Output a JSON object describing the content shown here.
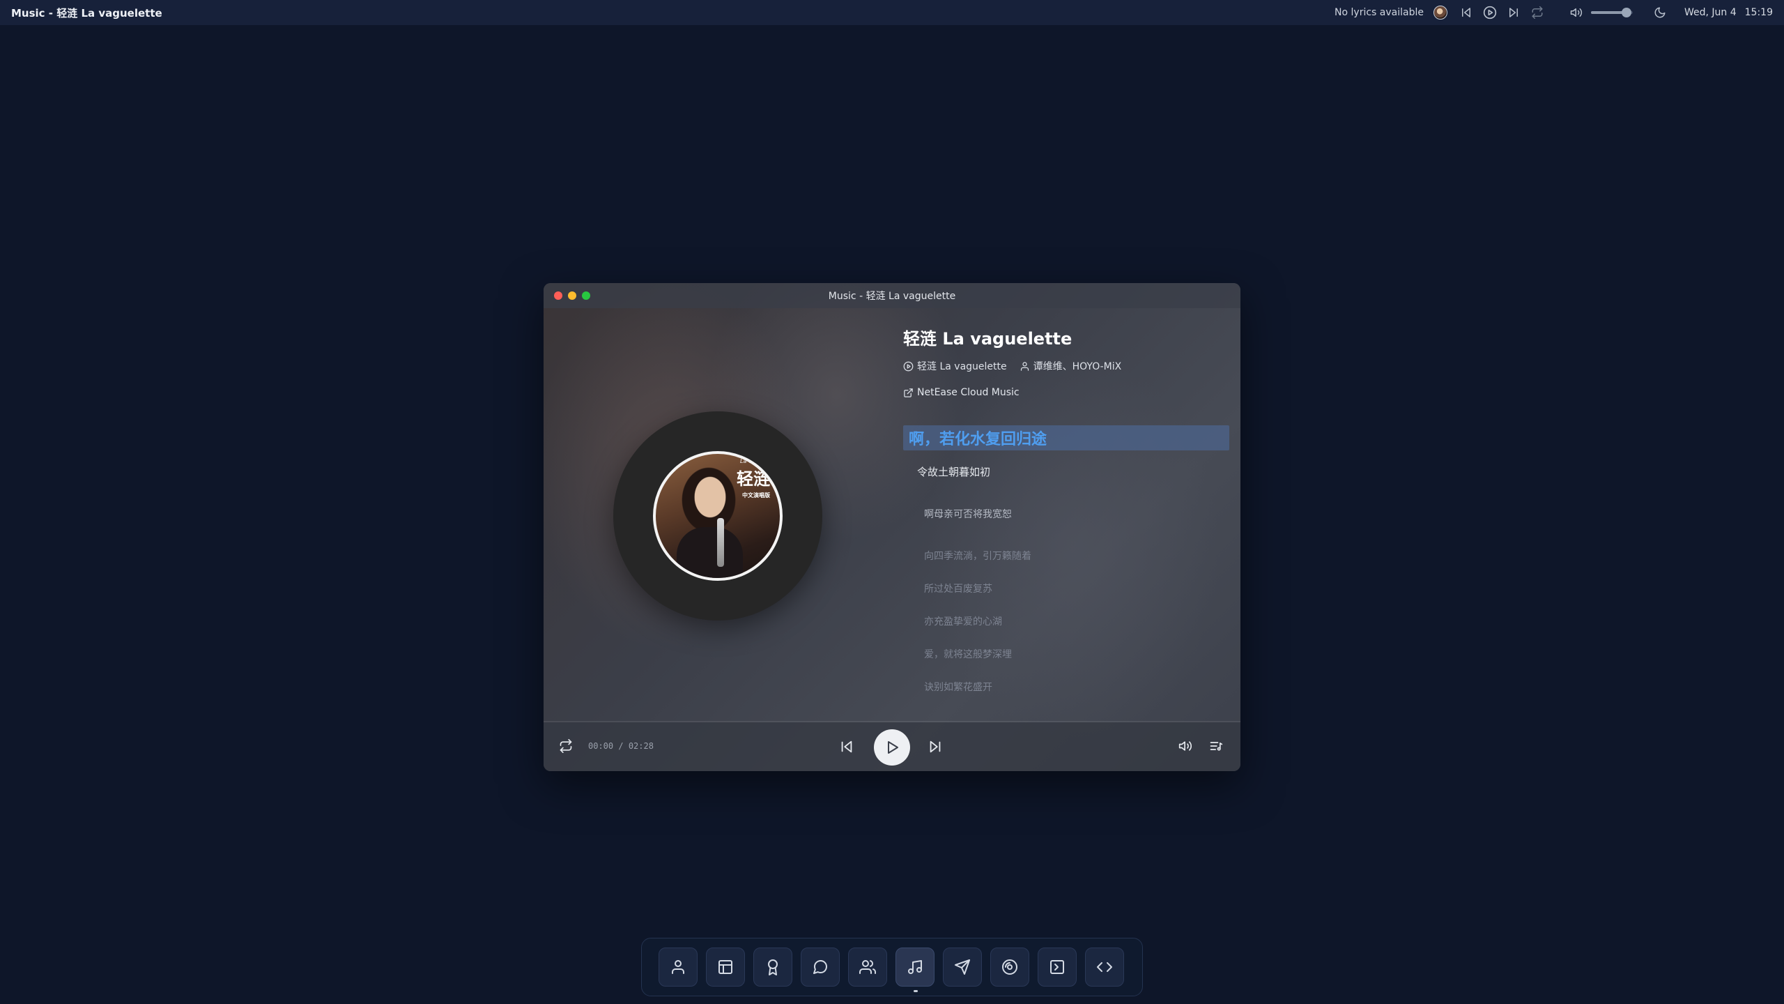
{
  "topbar": {
    "app_title": "Music - 轻涟 La vaguelette",
    "lyrics_status": "No lyrics available",
    "volume_level": 0.85,
    "date": "Wed, Jun 4",
    "time": "15:19"
  },
  "window": {
    "title": "Music - 轻涟 La vaguelette"
  },
  "cover": {
    "subtitle": "La vaguelette",
    "title": "轻涟",
    "tag": "中文演唱版"
  },
  "song": {
    "title": "轻涟 La vaguelette",
    "album": "轻涟 La vaguelette",
    "artists": "谭维维、HOYO-MiX",
    "source": "NetEase Cloud Music"
  },
  "lyrics": {
    "current": "啊，若化水复回归途",
    "lines": [
      "令故土朝暮如初",
      "啊母亲可否将我宽恕",
      "向四季流淌，引万籁随着",
      "所过处百废复苏",
      "亦充盈挚爱的心湖",
      "爱，就将这般梦深埋",
      "诀别如繁花盛开"
    ]
  },
  "player": {
    "elapsed": "00:00",
    "separator": "/",
    "duration": "02:28",
    "progress": 0
  },
  "dock": {
    "items": [
      {
        "icon": "user-icon"
      },
      {
        "icon": "layout-icon"
      },
      {
        "icon": "award-icon"
      },
      {
        "icon": "chat-icon"
      },
      {
        "icon": "users-icon"
      },
      {
        "icon": "music-icon",
        "active": true
      },
      {
        "icon": "send-icon"
      },
      {
        "icon": "disc-icon"
      },
      {
        "icon": "terminal-icon"
      },
      {
        "icon": "code-icon"
      }
    ]
  },
  "colors": {
    "desktop": "#0e1629",
    "lyric_highlight": "#4f9ef0",
    "close": "#ff5f57",
    "minimize": "#febc2e",
    "maximize": "#28c840"
  }
}
